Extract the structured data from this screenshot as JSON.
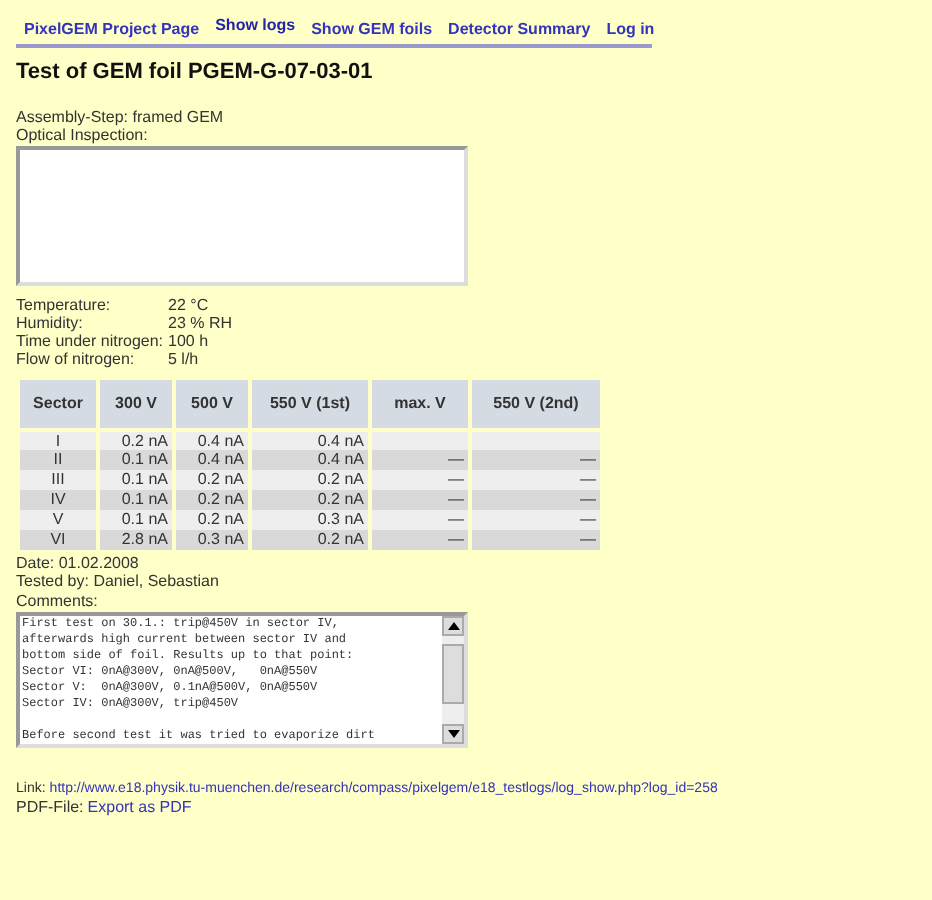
{
  "nav": [
    {
      "label": "PixelGEM Project Page",
      "selected": false
    },
    {
      "label": "Show logs",
      "selected": true
    },
    {
      "label": "Show GEM foils",
      "selected": false
    },
    {
      "label": "Detector Summary",
      "selected": false
    },
    {
      "label": "Log in",
      "selected": false
    }
  ],
  "title": "Test of GEM foil PGEM-G-07-03-01",
  "assembly_step": {
    "label": "Assembly-Step:",
    "value": "framed GEM"
  },
  "optical_inspection": {
    "label": "Optical Inspection:"
  },
  "conditions": [
    {
      "label": "Temperature:",
      "value": "22 °C"
    },
    {
      "label": "Humidity:",
      "value": "23 % RH"
    },
    {
      "label": "Time under nitrogen:",
      "value": "100 h"
    },
    {
      "label": "Flow of nitrogen:",
      "value": "5 l/h"
    }
  ],
  "table": {
    "columns": [
      "Sector",
      "300 V",
      "500 V",
      "550 V (1st)",
      "max. V",
      "550 V (2nd)"
    ],
    "rows": [
      [
        "I",
        "0.2 nA",
        "0.4 nA",
        "0.4 nA",
        null,
        null
      ],
      [
        "II",
        "0.1 nA",
        "0.4 nA",
        "0.4 nA",
        "—",
        "—"
      ],
      [
        "III",
        "0.1 nA",
        "0.2 nA",
        "0.2 nA",
        "—",
        "—"
      ],
      [
        "IV",
        "0.1 nA",
        "0.2 nA",
        "0.2 nA",
        "—",
        "—"
      ],
      [
        "V",
        "0.1 nA",
        "0.2 nA",
        "0.3 nA",
        "—",
        "—"
      ],
      [
        "VI",
        "2.8 nA",
        "0.3 nA",
        "0.2 nA",
        "—",
        "—"
      ]
    ]
  },
  "date": "Date: 01.02.2008",
  "tested_by": "Tested by: Daniel, Sebastian",
  "comments": {
    "label": "Comments:",
    "paragraphs": [
      [
        "First test on 30.1.: trip@450V in sector IV,",
        "afterwards high current between sector IV and",
        "bottom side of foil. Results up to that point:",
        "Sector VI: 0nA@300V, 0nA@500V,   0nA@550V",
        "Sector V:  0nA@300V, 0.1nA@500V, 0nA@550V",
        "Sector IV: 0nA@300V, trip@450V"
      ],
      [
        "Before second test it was tried to evaporize dirt"
      ]
    ]
  },
  "link": {
    "label": "Link:",
    "url": "http://www.e18.physik.tu-muenchen.de/research/compass/pixelgem/e18_testlogs/log_show.php?log_id=258"
  },
  "pdf": {
    "label": "PDF-File:",
    "action": "Export as PDF"
  }
}
